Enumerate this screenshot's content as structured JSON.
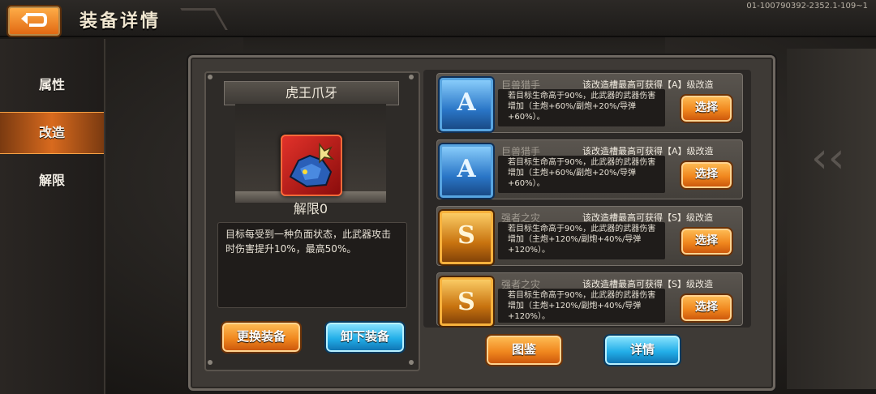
{
  "header": {
    "title": "装备详情",
    "version": "01-100790392-2352.1-109~1"
  },
  "sidebar": {
    "items": [
      {
        "label": "属性"
      },
      {
        "label": "改造"
      },
      {
        "label": "解限"
      }
    ]
  },
  "equipment": {
    "name": "虎王爪牙",
    "unlock": "解限0",
    "description": "目标每受到一种负面状态，此武器攻击时伤害提升10%，最高50%。",
    "change_button": "更换装备",
    "unload_button": "卸下装备"
  },
  "slots": [
    {
      "grade": "A",
      "name": "巨兽猎手",
      "cap": "该改造槽最高可获得【A】级改造",
      "desc": "若目标生命高于90%，此武器的武器伤害增加（主炮+60%/副炮+20%/导弹+60%）。",
      "button": "选择"
    },
    {
      "grade": "A",
      "name": "巨兽猎手",
      "cap": "该改造槽最高可获得【A】级改造",
      "desc": "若目标生命高于90%，此武器的武器伤害增加（主炮+60%/副炮+20%/导弹+60%）。",
      "button": "选择"
    },
    {
      "grade": "S",
      "name": "强者之灾",
      "cap": "该改造槽最高可获得【S】级改造",
      "desc": "若目标生命高于90%，此武器的武器伤害增加（主炮+120%/副炮+40%/导弹+120%）。",
      "button": "选择"
    },
    {
      "grade": "S",
      "name": "强者之灾",
      "cap": "该改造槽最高可获得【S】级改造",
      "desc": "若目标生命高于90%，此武器的武器伤害增加（主炮+120%/副炮+40%/导弹+120%）。",
      "button": "选择"
    }
  ],
  "bottom": {
    "catalog_button": "图鉴",
    "detail_button": "详情"
  },
  "colors": {
    "accent_orange": "#f0871e",
    "accent_blue": "#22aee8",
    "grade_a": "#2a76c7",
    "grade_s": "#c8730f"
  }
}
